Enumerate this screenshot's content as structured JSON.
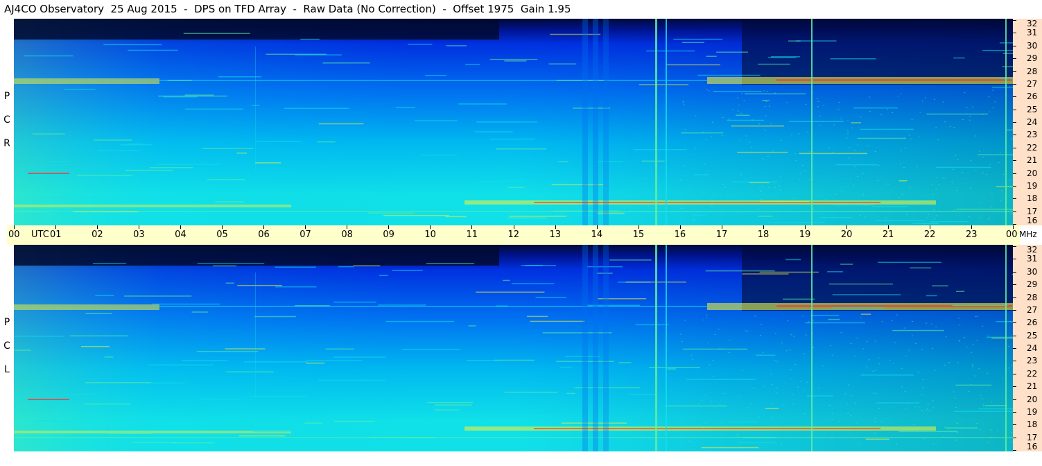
{
  "title": "AJ4CO Observatory  25 Aug 2015  -  DPS on TFD Array  -  Raw Data (No Correction)  -  Offset 1975  Gain 1.95",
  "polarizations": {
    "top": [
      "R",
      "C",
      "P"
    ],
    "bottom": [
      "L",
      "C",
      "P"
    ]
  },
  "time_axis": {
    "labels": [
      "00",
      "01",
      "02",
      "03",
      "04",
      "05",
      "06",
      "07",
      "08",
      "09",
      "10",
      "11",
      "12",
      "13",
      "14",
      "15",
      "16",
      "17",
      "18",
      "19",
      "20",
      "21",
      "22",
      "23",
      "00"
    ],
    "unit": "UTC"
  },
  "freq_axis": {
    "labels": [
      "32",
      "31",
      "30",
      "29",
      "28",
      "27",
      "26",
      "25",
      "24",
      "23",
      "22",
      "21",
      "20",
      "19",
      "18",
      "17",
      "16"
    ],
    "unit": "MHz"
  },
  "colors": {
    "deep": "#000a33",
    "navy": "#00128a",
    "blue": "#0030e0",
    "mid": "#0070f0",
    "cyan": "#00b8f0",
    "aqua": "#10e0e8",
    "green": "#60f0a0",
    "yellow": "#e8f040",
    "red": "#ff3030",
    "magenta": "#ff40c0"
  }
}
